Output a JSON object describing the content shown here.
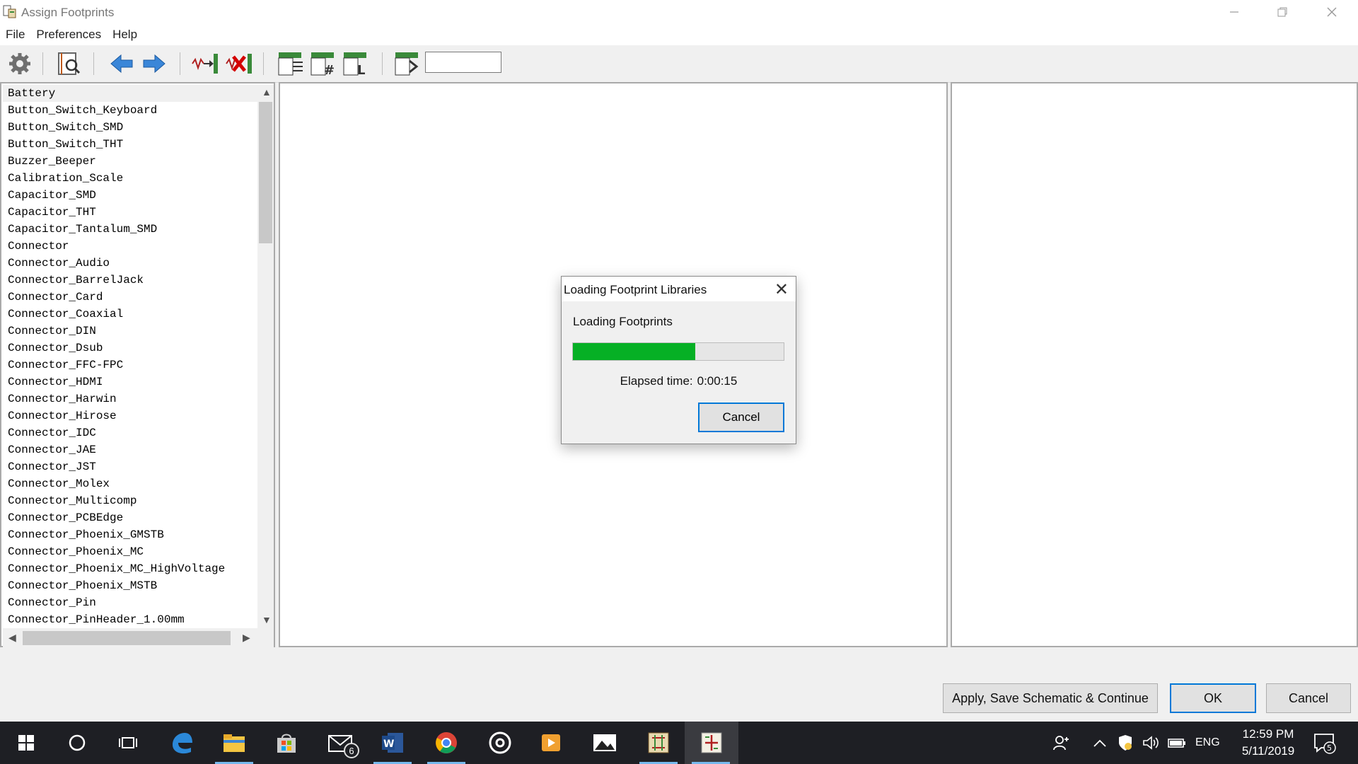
{
  "window": {
    "title": "Assign Footprints",
    "minimize_icon": "minimize-icon",
    "restore_icon": "restore-icon",
    "close_icon": "close-icon"
  },
  "menu": {
    "items": [
      {
        "label": "File"
      },
      {
        "label": "Preferences"
      },
      {
        "label": "Help"
      }
    ]
  },
  "toolbar": {
    "filter_value": "",
    "icons": [
      "settings-gear-icon",
      "view-footprint-icon",
      "previous-arrow-icon",
      "next-arrow-icon",
      "auto-associate-icon",
      "delete-associations-icon",
      "filter-by-keywords-icon",
      "filter-by-pin-count-icon",
      "filter-by-library-icon",
      "filter-by-text-icon"
    ]
  },
  "libraries": {
    "items": [
      "Battery",
      "Button_Switch_Keyboard",
      "Button_Switch_SMD",
      "Button_Switch_THT",
      "Buzzer_Beeper",
      "Calibration_Scale",
      "Capacitor_SMD",
      "Capacitor_THT",
      "Capacitor_Tantalum_SMD",
      "Connector",
      "Connector_Audio",
      "Connector_BarrelJack",
      "Connector_Card",
      "Connector_Coaxial",
      "Connector_DIN",
      "Connector_Dsub",
      "Connector_FFC-FPC",
      "Connector_HDMI",
      "Connector_Harwin",
      "Connector_Hirose",
      "Connector_IDC",
      "Connector_JAE",
      "Connector_JST",
      "Connector_Molex",
      "Connector_Multicomp",
      "Connector_PCBEdge",
      "Connector_Phoenix_GMSTB",
      "Connector_Phoenix_MC",
      "Connector_Phoenix_MC_HighVoltage",
      "Connector_Phoenix_MSTB",
      "Connector_Pin",
      "Connector_PinHeader_1.00mm"
    ]
  },
  "dialog": {
    "title": "Loading Footprint Libraries",
    "message": "Loading Footprints",
    "progress": 0.58,
    "elapsed_label": "Elapsed time:",
    "elapsed_value": "0:00:15",
    "cancel_label": "Cancel",
    "progress_color": "#06b025"
  },
  "buttons": {
    "apply_label": "Apply, Save Schematic & Continue",
    "ok_label": "OK",
    "cancel_label": "Cancel"
  },
  "taskbar": {
    "apps": [
      "start-windows-icon",
      "cortana-search-icon",
      "task-view-icon",
      "edge-browser-icon",
      "file-explorer-icon",
      "microsoft-store-icon",
      "mail-icon",
      "word-icon",
      "chrome-icon",
      "groove-music-icon",
      "movies-tv-icon",
      "photos-icon",
      "kicad-pcb-icon",
      "kicad-cvpcb-icon"
    ],
    "mail_badge": "6",
    "language": "ENG",
    "time": "12:59 PM",
    "date": "5/11/2019",
    "notification_count": "5"
  }
}
